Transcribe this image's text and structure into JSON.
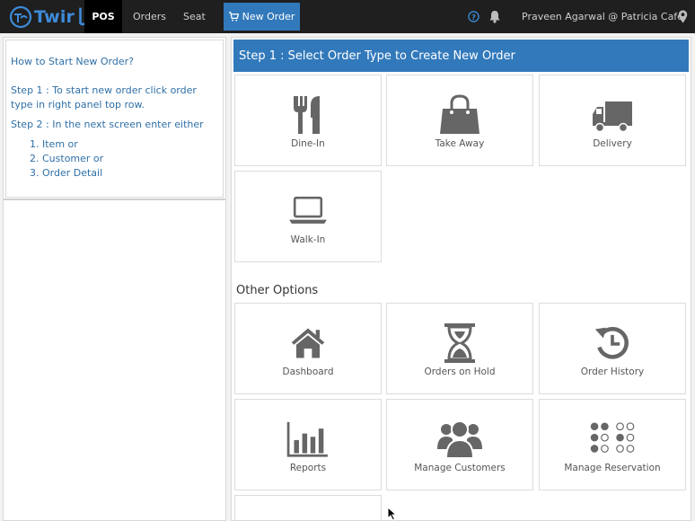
{
  "topbar": {
    "logo_text": "Twir",
    "nav_pos": "POS",
    "nav_orders": "Orders",
    "nav_seat": "Seat",
    "nav_new_order": "New Order",
    "user": "Praveen Agarwal @ Patricia Cafe",
    "icons": [
      "logo-icon",
      "cart-icon",
      "help-icon",
      "bell-icon",
      "location-pin-icon"
    ]
  },
  "help": {
    "question": "How to Start New Order?",
    "step1": "Step 1 : To start new order click order type in right panel top row.",
    "step2": "Step 2 : In the next screen enter either",
    "options": [
      "Item or",
      "Customer or",
      "Order Detail"
    ]
  },
  "main": {
    "step_header": "Step 1 : Select Order Type to Create New Order",
    "order_types": [
      {
        "label": "Dine-In",
        "icon": "fork-knife-icon"
      },
      {
        "label": "Take Away",
        "icon": "shopping-bag-icon"
      },
      {
        "label": "Delivery",
        "icon": "truck-icon"
      },
      {
        "label": "Walk-In",
        "icon": "laptop-icon"
      }
    ],
    "other_title": "Other Options",
    "other_options": [
      {
        "label": "Dashboard",
        "icon": "home-icon"
      },
      {
        "label": "Orders on Hold",
        "icon": "hourglass-icon"
      },
      {
        "label": "Order History",
        "icon": "history-icon"
      },
      {
        "label": "Reports",
        "icon": "bar-chart-icon"
      },
      {
        "label": "Manage Customers",
        "icon": "users-icon"
      },
      {
        "label": "Manage Reservation",
        "icon": "reservation-grid-icon"
      }
    ]
  },
  "colors": {
    "topbar_bg": "#1f1f1f",
    "accent": "#3279bb",
    "link_text": "#2f6fa6",
    "icon_gray": "#666666"
  }
}
